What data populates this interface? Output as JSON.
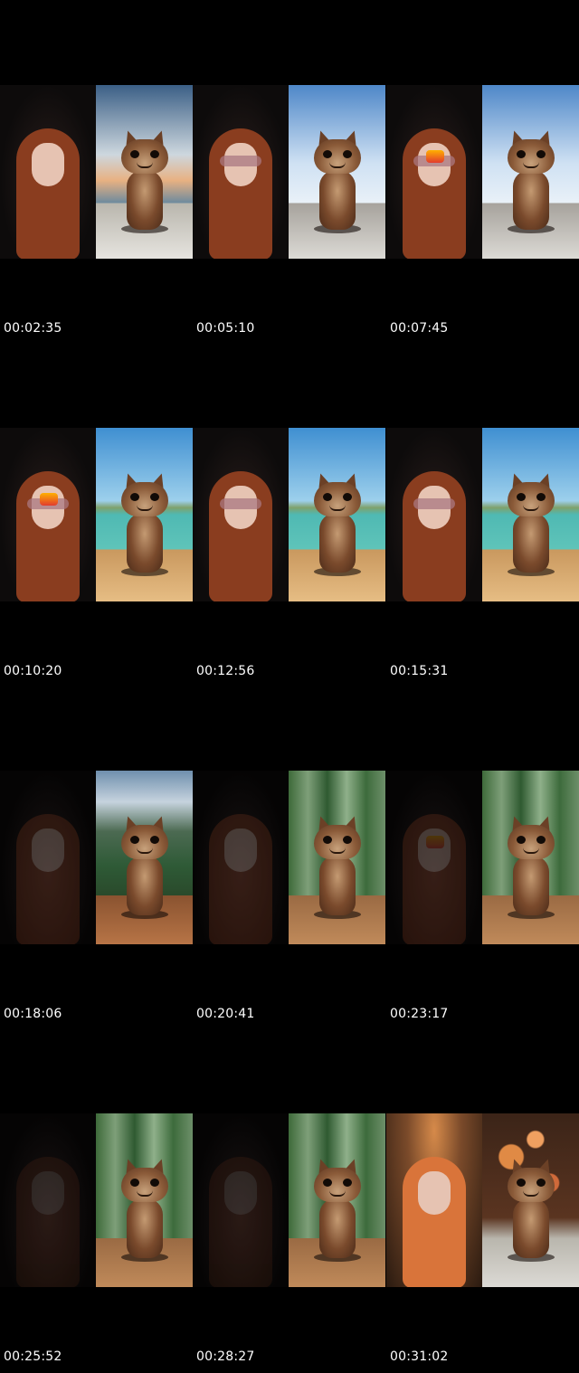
{
  "frames": [
    {
      "timecode": "00:02:35",
      "person": "car",
      "sticker": false,
      "shades": false,
      "cat_bg": "sunset"
    },
    {
      "timecode": "00:05:10",
      "person": "car",
      "sticker": false,
      "shades": true,
      "cat_bg": "sky"
    },
    {
      "timecode": "00:07:45",
      "person": "car",
      "sticker": true,
      "shades": true,
      "cat_bg": "sky"
    },
    {
      "timecode": "00:10:20",
      "person": "car",
      "sticker": true,
      "shades": true,
      "cat_bg": "beach"
    },
    {
      "timecode": "00:12:56",
      "person": "car",
      "sticker": false,
      "shades": true,
      "cat_bg": "beach"
    },
    {
      "timecode": "00:15:31",
      "person": "car",
      "sticker": false,
      "shades": true,
      "cat_bg": "beach"
    },
    {
      "timecode": "00:18:06",
      "person": "dark",
      "sticker": false,
      "shades": false,
      "cat_bg": "mountain"
    },
    {
      "timecode": "00:20:41",
      "person": "dark",
      "sticker": false,
      "shades": false,
      "cat_bg": "foliage"
    },
    {
      "timecode": "00:23:17",
      "person": "dark",
      "sticker": true,
      "shades": false,
      "cat_bg": "foliage"
    },
    {
      "timecode": "00:25:52",
      "person": "darker",
      "sticker": false,
      "shades": false,
      "cat_bg": "foliage"
    },
    {
      "timecode": "00:28:27",
      "person": "darker",
      "sticker": false,
      "shades": false,
      "cat_bg": "foliage"
    },
    {
      "timecode": "00:31:02",
      "person": "room",
      "sticker": false,
      "shades": false,
      "cat_bg": "bokeh"
    }
  ],
  "colors": {
    "background": "#000000",
    "timecode_text": "#ffffff"
  },
  "icons": {
    "sticker": "emoji-sticker-icon",
    "cat": "cat-figure-icon"
  }
}
